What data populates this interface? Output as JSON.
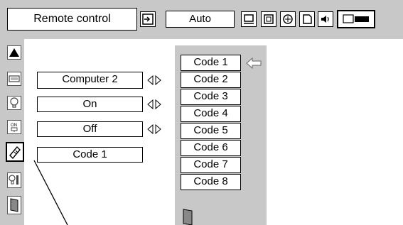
{
  "toolbar": {
    "title": "Remote control",
    "mode_value": "Auto",
    "icons": [
      "input-icon",
      "image-adjust-icon",
      "screen-icon",
      "color-icon",
      "setting-icon",
      "sound-icon",
      "remote-icon"
    ]
  },
  "settings": {
    "rows": [
      {
        "icon": "image-select-icon",
        "value": "Computer 2",
        "has_arrows": true
      },
      {
        "icon": "lamp-icon",
        "value": "On",
        "has_arrows": true
      },
      {
        "icon": "power-management-icon",
        "value": "Off",
        "has_arrows": true
      },
      {
        "icon": "remote-control-icon",
        "value": "Code 1",
        "has_arrows": false
      }
    ]
  },
  "code_list": {
    "items": [
      "Code 1",
      "Code 2",
      "Code 3",
      "Code 4",
      "Code 5",
      "Code 6",
      "Code 7",
      "Code 8"
    ],
    "selected": "Code 1"
  },
  "colors": {
    "panel": "#c8c8c8",
    "background": "#ffffff",
    "border": "#000000"
  }
}
